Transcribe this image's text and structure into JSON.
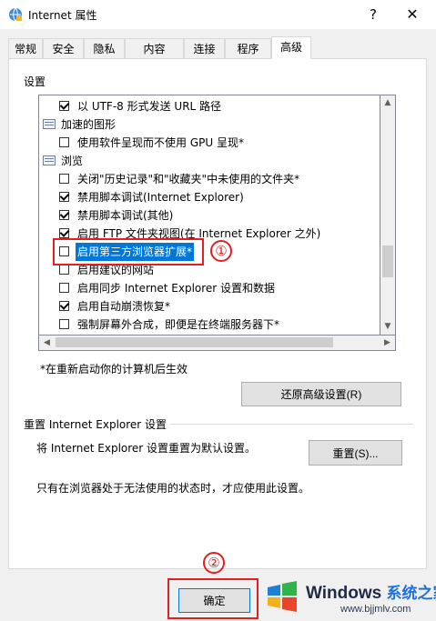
{
  "window": {
    "title": "Internet 属性",
    "help_label": "?",
    "close_label": "✕"
  },
  "tabs": [
    {
      "label": "常规"
    },
    {
      "label": "安全"
    },
    {
      "label": "隐私"
    },
    {
      "label": "内容"
    },
    {
      "label": "连接"
    },
    {
      "label": "程序"
    },
    {
      "label": "高级"
    }
  ],
  "active_tab": "高级",
  "settings": {
    "section_label": "设置",
    "items": [
      {
        "type": "checkbox",
        "checked": true,
        "label": "以 UTF-8 形式发送 URL 路径"
      },
      {
        "type": "group",
        "label": "加速的图形"
      },
      {
        "type": "checkbox",
        "checked": false,
        "label": "使用软件呈现而不使用 GPU 呈现*"
      },
      {
        "type": "group",
        "label": "浏览"
      },
      {
        "type": "checkbox",
        "checked": false,
        "label": "关闭\"历史记录\"和\"收藏夹\"中未使用的文件夹*"
      },
      {
        "type": "checkbox",
        "checked": true,
        "label": "禁用脚本调试(Internet Explorer)"
      },
      {
        "type": "checkbox",
        "checked": true,
        "label": "禁用脚本调试(其他)"
      },
      {
        "type": "checkbox",
        "checked": true,
        "label": "启用 FTP 文件夹视图(在 Internet Explorer 之外)"
      },
      {
        "type": "checkbox",
        "checked": false,
        "label": "启用第三方浏览器扩展*",
        "selected": true
      },
      {
        "type": "checkbox",
        "checked": false,
        "label": "启用建议的网站"
      },
      {
        "type": "checkbox",
        "checked": false,
        "label": "启用同步 Internet Explorer 设置和数据"
      },
      {
        "type": "checkbox",
        "checked": true,
        "label": "启用自动崩溃恢复*"
      },
      {
        "type": "checkbox",
        "checked": false,
        "label": "强制屏幕外合成，即便是在终端服务器下*"
      }
    ],
    "footnote": "*在重新启动你的计算机后生效",
    "restore_button": "还原高级设置(R)"
  },
  "reset": {
    "group_label": "重置 Internet Explorer 设置",
    "description": "将 Internet Explorer 设置重置为默认设置。",
    "button": "重置(S)...",
    "note": "只有在浏览器处于无法使用的状态时，才应使用此设置。"
  },
  "ok_button": "确定",
  "annotations": {
    "marker1": "①",
    "marker2": "②",
    "color": "#e51f1f"
  },
  "watermark": {
    "brand": "Windows",
    "brand_cn": "系统之家",
    "url": "www.bjjmlv.com"
  },
  "colors": {
    "selection": "#0078d7",
    "accent": "#0078d7"
  }
}
